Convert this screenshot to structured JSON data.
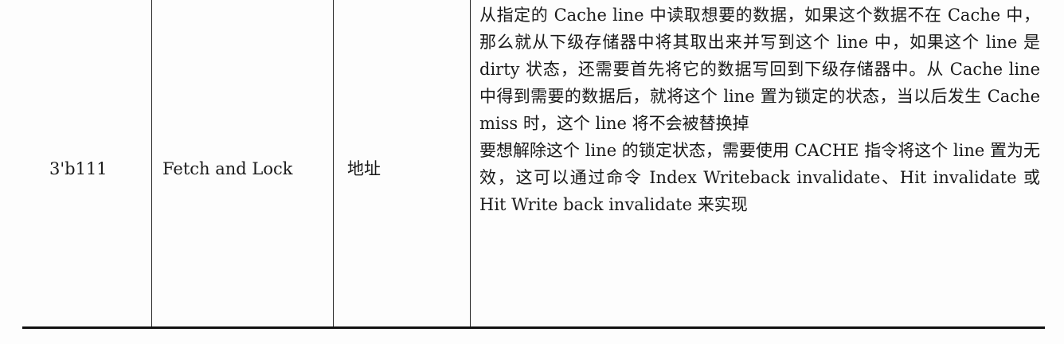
{
  "table": {
    "row": {
      "code": "3'b111",
      "operation": "Fetch and Lock",
      "address_type": "地址",
      "description": [
        "从指定的 Cache line 中读取想要的数据，如果这个数据不在 Cache 中，那么就从下级存储器中将其取出来并写到这个 line 中，如果这个 line 是 dirty 状态，还需要首先将它的数据写回到下级存储器中。从 Cache line 中得到需要的数据后，就将这个 line 置为锁定的状态，当以后发生 Cache miss 时，这个 line 将不会被替换掉",
        "要想解除这个 line 的锁定状态，需要使用 CACHE 指令将这个 line 置为无效，这可以通过命令 Index Writeback invalidate、Hit invalidate 或 Hit Write back invalidate 来实现"
      ]
    }
  }
}
